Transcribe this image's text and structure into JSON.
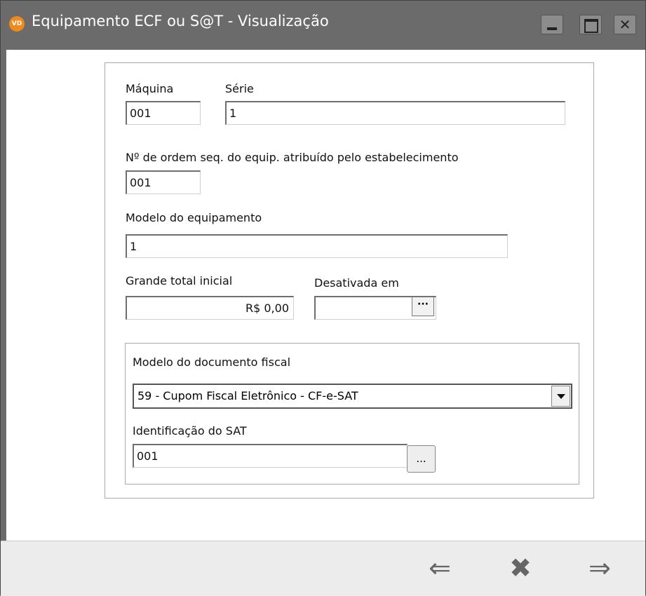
{
  "window": {
    "title": "Equipamento ECF ou S@T - Visualização",
    "app_icon_text": "VD"
  },
  "form": {
    "maquina": {
      "label": "Máquina",
      "value": "001"
    },
    "serie": {
      "label": "Série",
      "value": "1"
    },
    "ordem": {
      "label": "Nº de ordem seq. do equip. atribuído pelo estabelecimento",
      "value": "001"
    },
    "modelo_equip": {
      "label": "Modelo do equipamento",
      "value": "1"
    },
    "grande_total": {
      "label": "Grande total inicial",
      "value": "R$ 0,00"
    },
    "desativada": {
      "label": "Desativada em",
      "value": "",
      "button_label": "···"
    }
  },
  "documento": {
    "modelo_label": "Modelo do documento fiscal",
    "modelo_value": "59 - Cupom Fiscal Eletrônico - CF-e-SAT",
    "sat_label": "Identificação do SAT",
    "sat_value": "001",
    "sat_button_label": "..."
  },
  "footer": {
    "prev_icon": "⇐",
    "cancel_icon": "✖",
    "next_icon": "⇒"
  },
  "icons": [
    "app-icon",
    "minimize-icon",
    "maximize-icon",
    "close-icon",
    "calendar-picker-icon",
    "dropdown-arrow-icon",
    "lookup-icon",
    "previous-arrow-icon",
    "cancel-icon",
    "next-arrow-icon"
  ]
}
